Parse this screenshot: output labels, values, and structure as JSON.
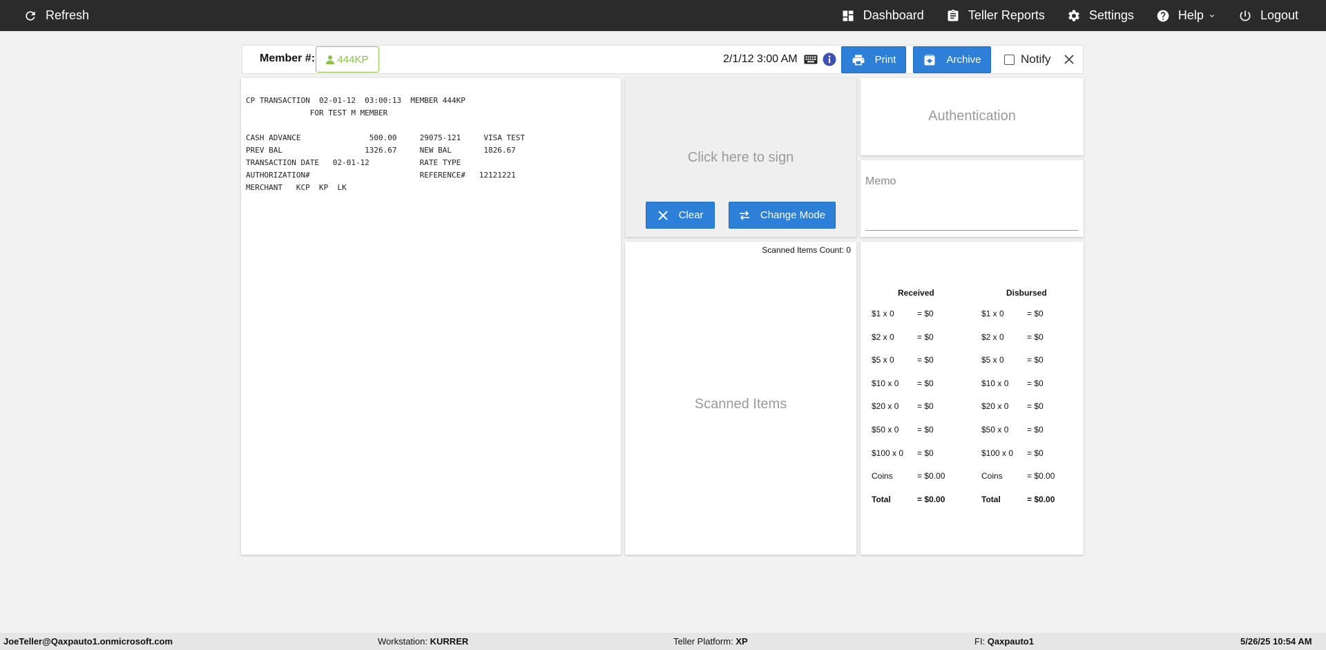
{
  "nav": {
    "refresh": "Refresh",
    "dashboard": "Dashboard",
    "teller_reports": "Teller Reports",
    "settings": "Settings",
    "help": "Help",
    "logout": "Logout"
  },
  "header": {
    "member_label": "Member #:",
    "member_number": "444KP",
    "datetime": "2/1/12 3:00 AM",
    "print_label": "Print",
    "archive_label": "Archive",
    "notify_label": "Notify",
    "notify_checked": false
  },
  "receipt": {
    "lines": [
      "CP TRANSACTION  02-01-12  03:00:13  MEMBER 444KP",
      "              FOR TEST M MEMBER",
      "",
      "CASH ADVANCE               500.00     29075-121     VISA TEST",
      "PREV BAL                  1326.67     NEW BAL       1826.67",
      "TRANSACTION DATE   02-01-12           RATE TYPE",
      "AUTHORIZATION#                        REFERENCE#   12121221",
      "MERCHANT   KCP  KP  LK"
    ]
  },
  "signature": {
    "prompt": "Click here to sign",
    "clear_label": "Clear",
    "change_mode_label": "Change Mode"
  },
  "authentication": {
    "label": "Authentication"
  },
  "memo": {
    "label": "Memo"
  },
  "scanned": {
    "count_text": "Scanned Items Count: 0",
    "label": "Scanned Items"
  },
  "cash": {
    "received": {
      "heading": "Received",
      "rows": [
        {
          "den": "$1 x 0",
          "amt": "= $0"
        },
        {
          "den": "$2 x 0",
          "amt": "= $0"
        },
        {
          "den": "$5 x 0",
          "amt": "= $0"
        },
        {
          "den": "$10 x 0",
          "amt": "= $0"
        },
        {
          "den": "$20 x 0",
          "amt": "= $0"
        },
        {
          "den": "$50 x 0",
          "amt": "= $0"
        },
        {
          "den": "$100 x 0",
          "amt": "= $0"
        },
        {
          "den": "Coins",
          "amt": "= $0.00"
        }
      ],
      "total_label": "Total",
      "total_amt": "= $0.00"
    },
    "disbursed": {
      "heading": "Disbursed",
      "rows": [
        {
          "den": "$1 x 0",
          "amt": "= $0"
        },
        {
          "den": "$2 x 0",
          "amt": "= $0"
        },
        {
          "den": "$5 x 0",
          "amt": "= $0"
        },
        {
          "den": "$10 x 0",
          "amt": "= $0"
        },
        {
          "den": "$20 x 0",
          "amt": "= $0"
        },
        {
          "den": "$50 x 0",
          "amt": "= $0"
        },
        {
          "den": "$100 x 0",
          "amt": "= $0"
        },
        {
          "den": "Coins",
          "amt": "= $0.00"
        }
      ],
      "total_label": "Total",
      "total_amt": "= $0.00"
    }
  },
  "footer": {
    "user": "JoeTeller@Qaxpauto1.onmicrosoft.com",
    "workstation_label": "Workstation:",
    "workstation": "KURRER",
    "platform_label": "Teller Platform:",
    "platform": "XP",
    "fi_label": "FI:",
    "fi": "Qaxpauto1",
    "datetime": "5/26/25 10:54 AM"
  },
  "colors": {
    "topbar": "#2b2b2b",
    "accent_blue": "#2d7fd8",
    "member_green": "#8bc34a",
    "background": "#f2f2f2"
  },
  "icons": {
    "refresh": "refresh-icon",
    "dashboard": "dashboard-icon",
    "teller_reports": "clipboard-icon",
    "settings": "gear-icon",
    "help": "help-circle-icon",
    "logout": "power-icon",
    "member": "user-icon",
    "keyboard": "keyboard-icon",
    "info": "info-icon",
    "print": "printer-icon",
    "archive": "archive-icon",
    "close": "close-icon",
    "clear": "x-icon",
    "change_mode": "swap-icon"
  }
}
